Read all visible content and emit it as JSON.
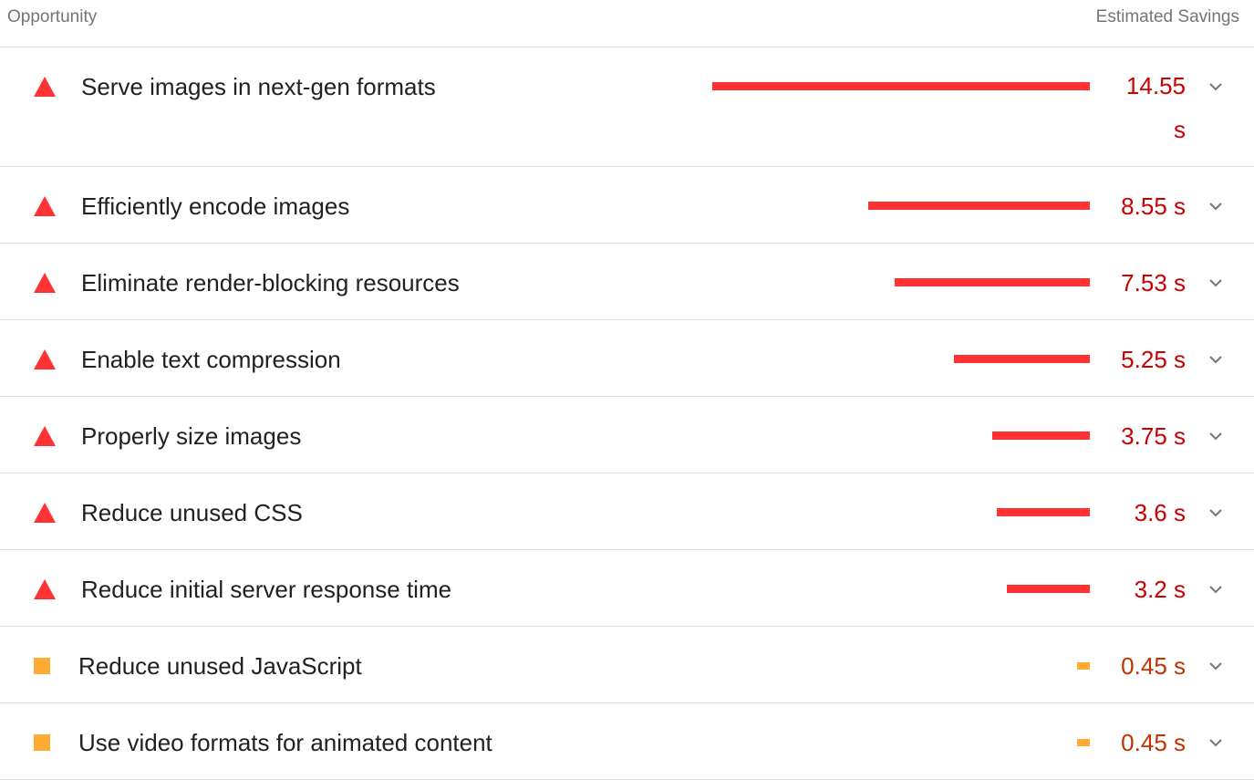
{
  "header": {
    "left_label": "Opportunity",
    "right_label": "Estimated Savings"
  },
  "opportunities": [
    {
      "title": "Serve images in next-gen formats",
      "savings": "14.55 s",
      "savings_value": 14.55,
      "rating": "fail",
      "icon": "fail-triangle-icon"
    },
    {
      "title": "Efficiently encode images",
      "savings": "8.55 s",
      "savings_value": 8.55,
      "rating": "fail",
      "icon": "fail-triangle-icon"
    },
    {
      "title": "Eliminate render-blocking resources",
      "savings": "7.53 s",
      "savings_value": 7.53,
      "rating": "fail",
      "icon": "fail-triangle-icon"
    },
    {
      "title": "Enable text compression",
      "savings": "5.25 s",
      "savings_value": 5.25,
      "rating": "fail",
      "icon": "fail-triangle-icon"
    },
    {
      "title": "Properly size images",
      "savings": "3.75 s",
      "savings_value": 3.75,
      "rating": "fail",
      "icon": "fail-triangle-icon"
    },
    {
      "title": "Reduce unused CSS",
      "savings": "3.6 s",
      "savings_value": 3.6,
      "rating": "fail",
      "icon": "fail-triangle-icon"
    },
    {
      "title": "Reduce initial server response time",
      "savings": "3.2 s",
      "savings_value": 3.2,
      "rating": "fail",
      "icon": "fail-triangle-icon"
    },
    {
      "title": "Reduce unused JavaScript",
      "savings": "0.45 s",
      "savings_value": 0.45,
      "rating": "average",
      "icon": "average-square-icon"
    },
    {
      "title": "Use video formats for animated content",
      "savings": "0.45 s",
      "savings_value": 0.45,
      "rating": "average",
      "icon": "average-square-icon"
    }
  ],
  "colors": {
    "fail": "#ff3333",
    "fail_text": "#cc0000",
    "average": "#ffaa33",
    "average_text": "#c33300"
  },
  "expand_icon": "chevron-down-icon"
}
